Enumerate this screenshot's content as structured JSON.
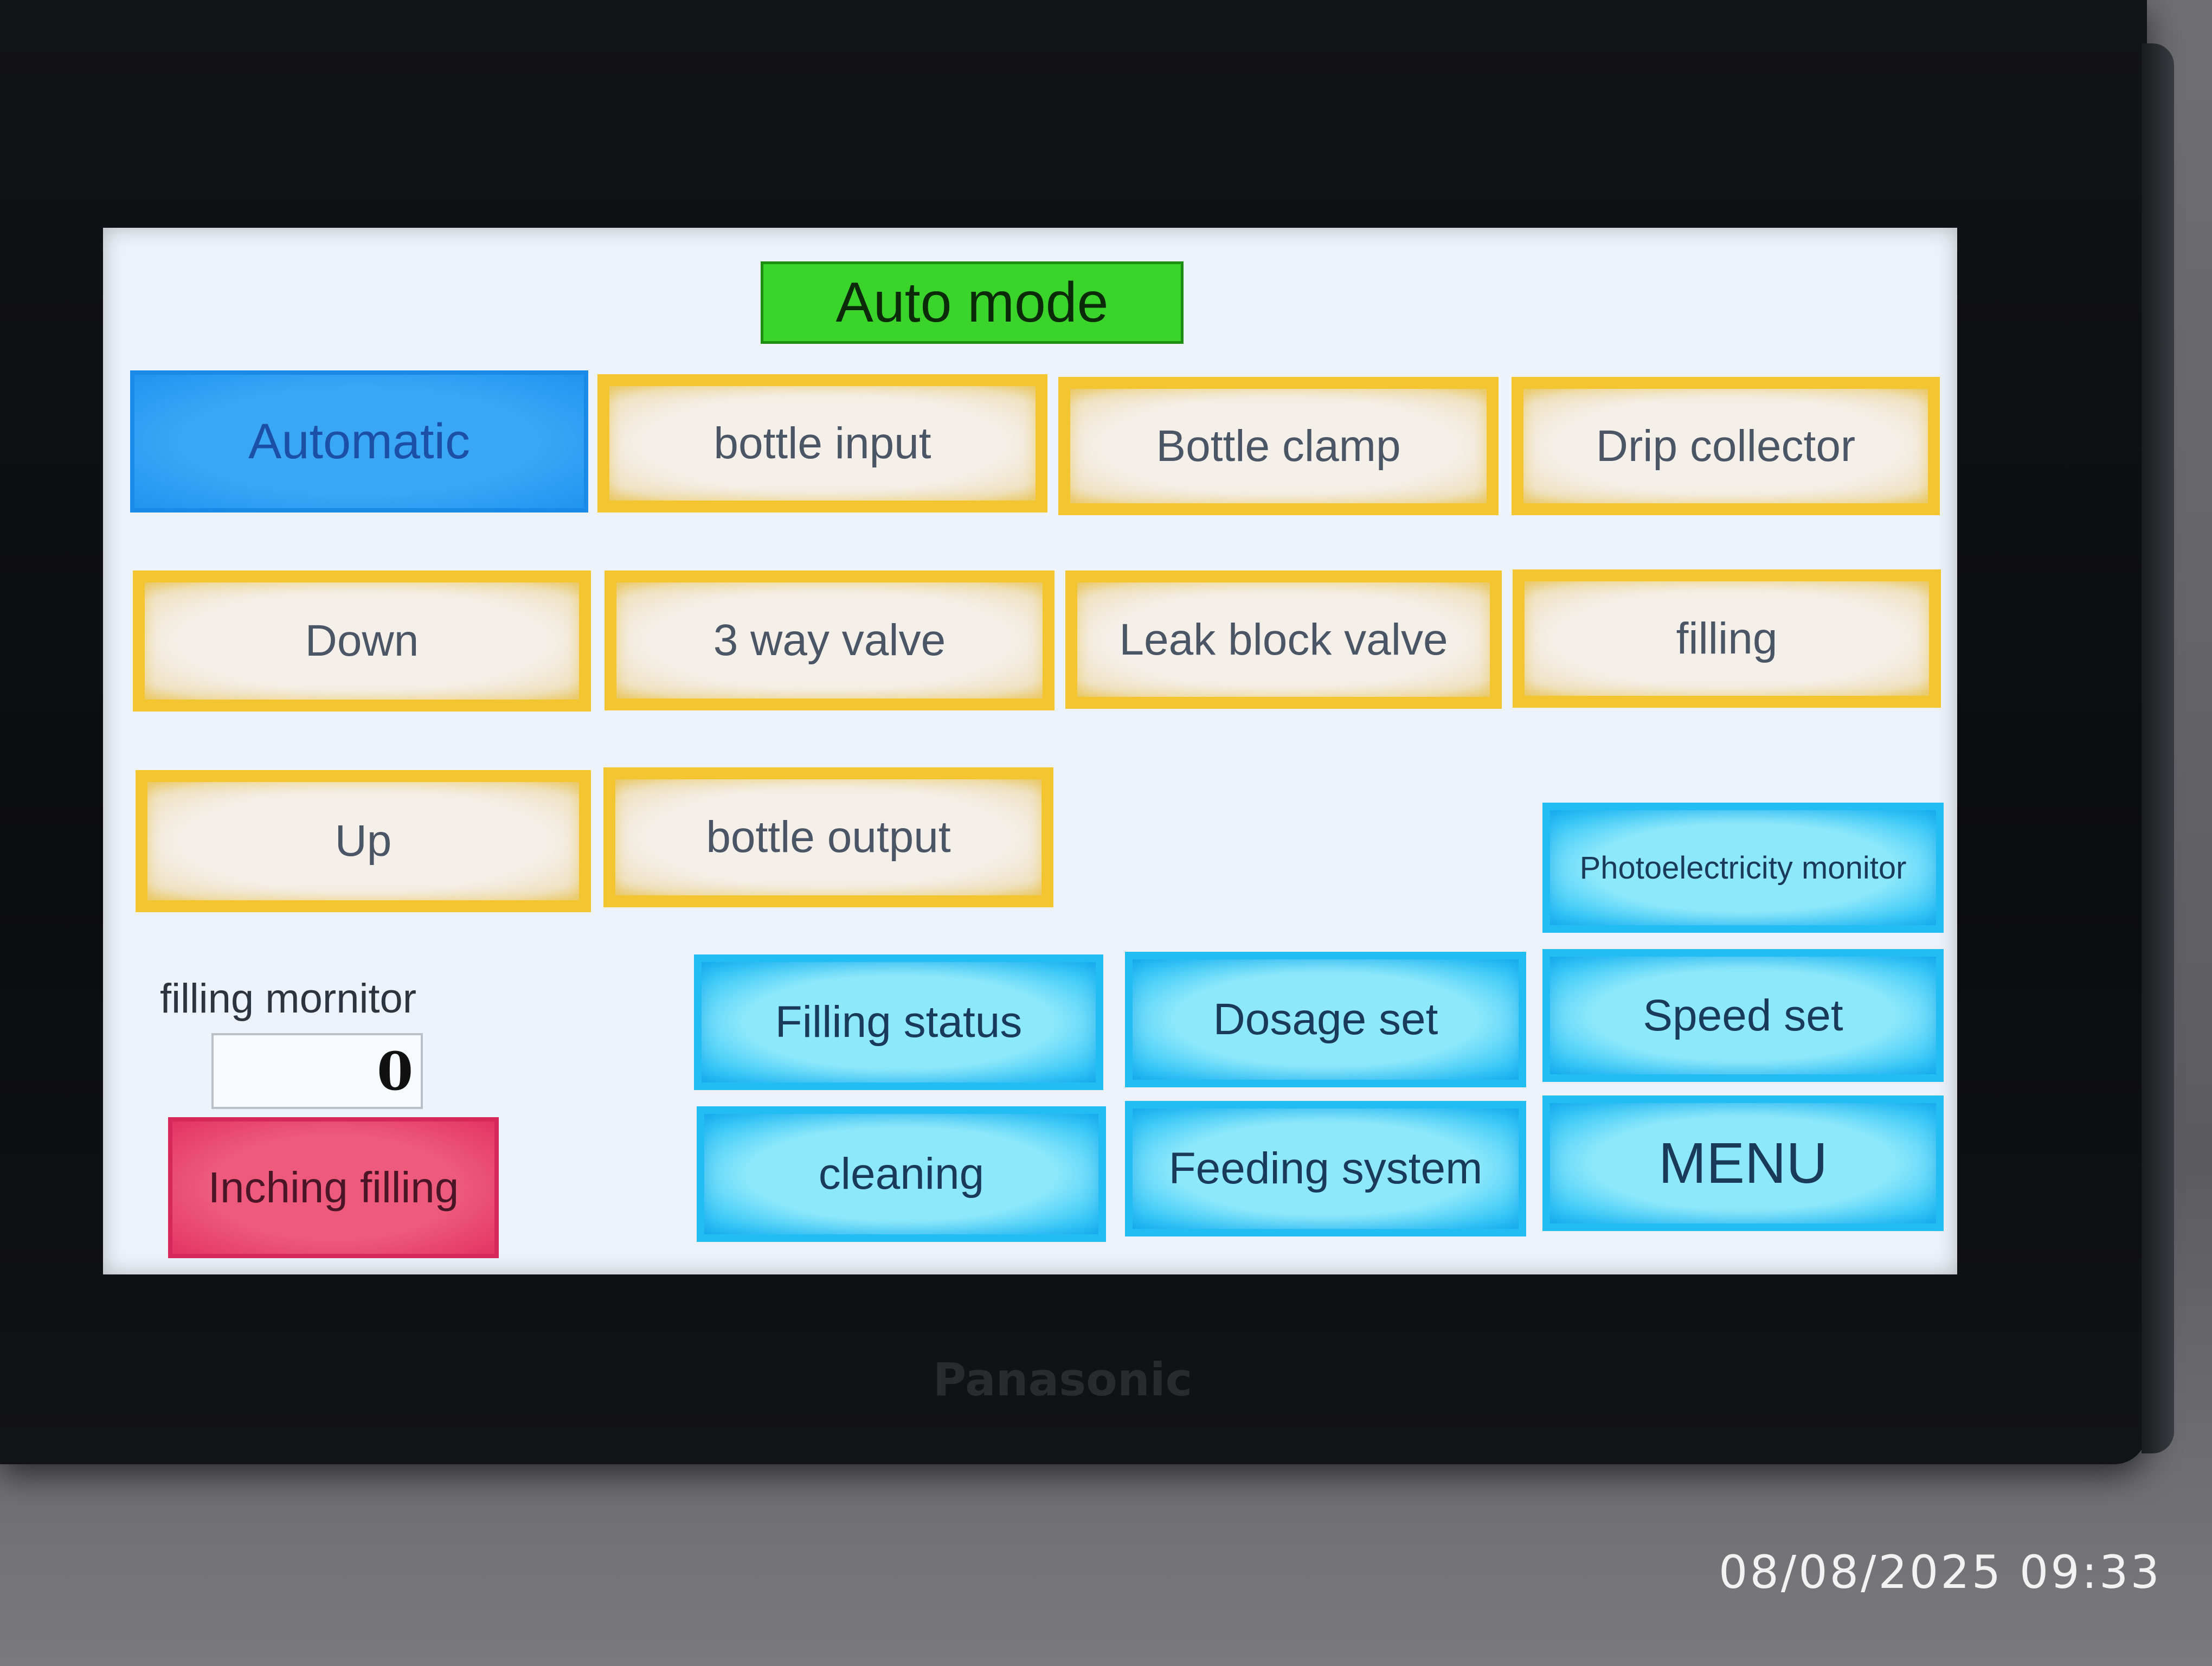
{
  "header": {
    "title": "Auto mode"
  },
  "buttons": {
    "automatic": "Automatic",
    "bottle_input": "bottle input",
    "bottle_clamp": "Bottle clamp",
    "drip_collector": "Drip collector",
    "down": "Down",
    "three_way_valve": "3 way valve",
    "leak_block_valve": "Leak block valve",
    "filling": "filling",
    "up": "Up",
    "bottle_output": "bottle output",
    "photoelectricity_monitor": "Photoelectricity monitor",
    "filling_status": "Filling status",
    "dosage_set": "Dosage set",
    "speed_set": "Speed  set",
    "cleaning": "cleaning",
    "feeding_system": "Feeding system",
    "menu": "MENU",
    "inching_filling": "Inching filling"
  },
  "monitor": {
    "label": "filling mornitor",
    "value": "0"
  },
  "device": {
    "brand": "Panasonic"
  },
  "photo": {
    "timestamp": "08/08/2025 09:33"
  },
  "colors": {
    "mode_indicator": "#3bd42b",
    "active_button": "#2194ef",
    "toggle_border": "#f2c531",
    "nav_button": "#38c8f7",
    "alert_button": "#e23463",
    "screen_background": "#eef3fb",
    "bezel": "#0b0c0e"
  }
}
